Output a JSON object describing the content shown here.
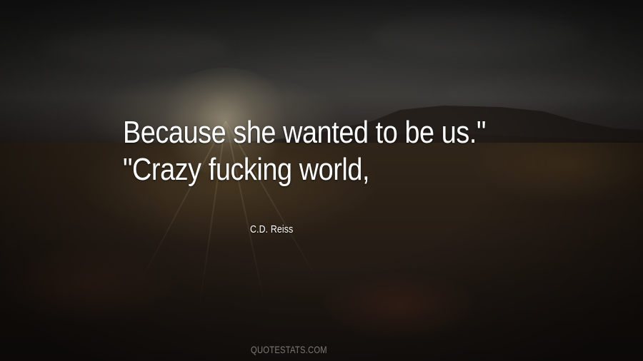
{
  "quote": {
    "line1": "Because she wanted to be us.\"",
    "line2": "\"Crazy fucking world,"
  },
  "author": "C.D. Reiss",
  "watermark": "QUOTESTATS.COM",
  "colors": {
    "text": "#ffffff",
    "watermark": "#d2cdc8",
    "sky": "#3a3a38",
    "field": "#33271c"
  }
}
